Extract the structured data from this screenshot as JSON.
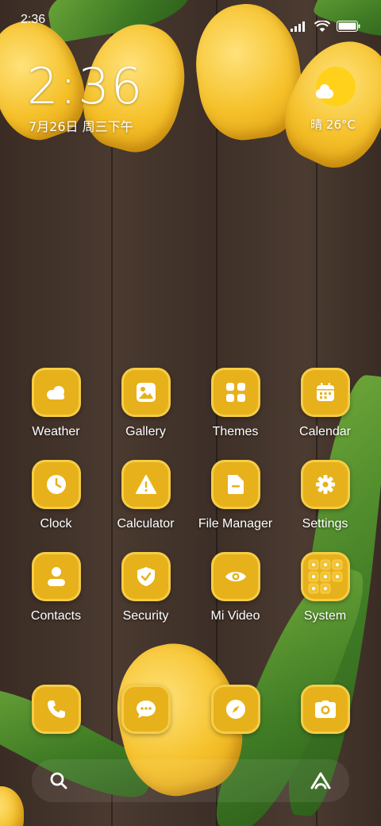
{
  "status_bar": {
    "time": "2:36",
    "icons": [
      "signal-icon",
      "wifi-icon",
      "battery-icon"
    ]
  },
  "clock_widget": {
    "time": "2:36",
    "date": "7月26日 周三下午"
  },
  "weather_widget": {
    "icon": "sun-cloud-icon",
    "text": "晴 26°C"
  },
  "apps": [
    {
      "label": "Weather",
      "icon": "weather-icon"
    },
    {
      "label": "Gallery",
      "icon": "gallery-icon"
    },
    {
      "label": "Themes",
      "icon": "themes-icon"
    },
    {
      "label": "Calendar",
      "icon": "calendar-icon"
    },
    {
      "label": "Clock",
      "icon": "clock-icon"
    },
    {
      "label": "Calculator",
      "icon": "calculator-icon"
    },
    {
      "label": "File Manager",
      "icon": "folder-icon"
    },
    {
      "label": "Settings",
      "icon": "gear-icon"
    },
    {
      "label": "Contacts",
      "icon": "contacts-icon"
    },
    {
      "label": "Security",
      "icon": "shield-icon"
    },
    {
      "label": "Mi Video",
      "icon": "eye-icon"
    },
    {
      "label": "System",
      "icon": "folder-grid-icon"
    }
  ],
  "dock": [
    {
      "icon": "phone-icon"
    },
    {
      "icon": "messages-icon"
    },
    {
      "icon": "compass-icon"
    },
    {
      "icon": "camera-icon"
    }
  ],
  "search_bar": {
    "left_icon": "search-icon",
    "right_icon": "assistant-icon"
  },
  "colors": {
    "icon_background": "#e7b11b",
    "icon_border": "#f6cd45",
    "glyph": "#ffffff"
  }
}
